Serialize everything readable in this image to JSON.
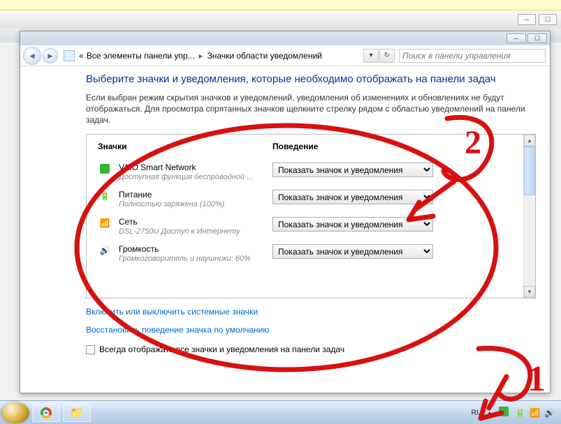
{
  "breadcrumb": {
    "icon_sep": "«",
    "part1": "Все элементы панели упр...",
    "sep": "▸",
    "part2": "Значки области уведомлений"
  },
  "search": {
    "placeholder": "Поиск в панели управления"
  },
  "heading": "Выберите значки и уведомления, которые необходимо отображать на панели задач",
  "subtext": "Если выбран режим скрытия значков и уведомлений, уведомления об изменениях и обновлениях не будут отображаться. Для просмотра спрятанных значков щелкните стрелку рядом с областью уведомлений на панели задач.",
  "columns": {
    "c1": "Значки",
    "c2": "Поведение"
  },
  "behaviors": {
    "default": "Показать значок и уведомления"
  },
  "rows": [
    {
      "title": "VAIO Smart Network",
      "desc": "Доступная функция беспроводной ...",
      "icon": "green"
    },
    {
      "title": "Питание",
      "desc": "Полностью заряжена (100%)",
      "icon": "battery"
    },
    {
      "title": "Сеть",
      "desc": "DSL-2750U Доступ к Интернету",
      "icon": "network"
    },
    {
      "title": "Громкость",
      "desc": "Громкоговоритель и наушники: 60%",
      "icon": "volume"
    }
  ],
  "links": {
    "l1": "Включить или выключить системные значки",
    "l2": "Восстановить поведение значка по умолчанию"
  },
  "checkbox_label": "Всегда отображать все значки и уведомления на панели задач",
  "tray": {
    "lang": "RU"
  },
  "annotations": {
    "one": "1",
    "two": "2"
  }
}
